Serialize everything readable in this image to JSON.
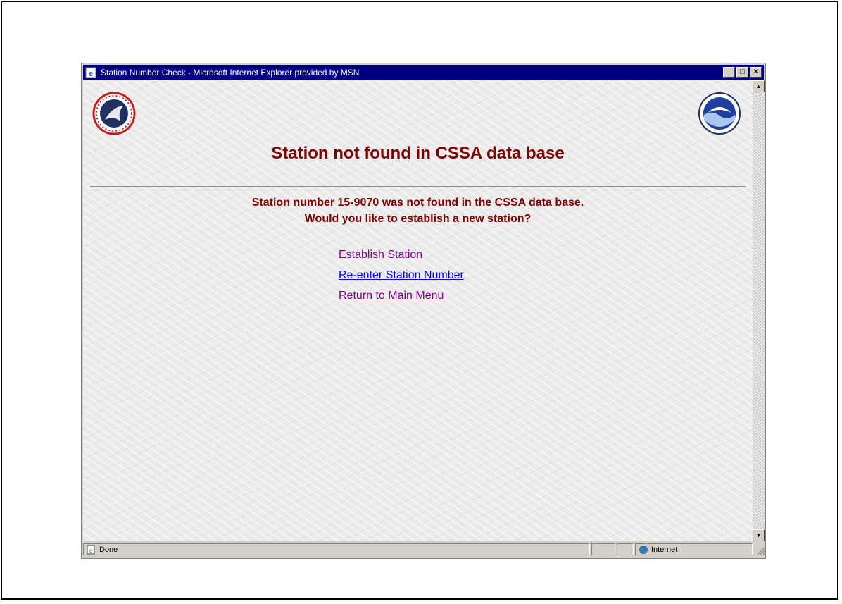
{
  "window": {
    "title": "Station Number Check - Microsoft Internet Explorer provided by MSN",
    "minimize": "_",
    "maximize": "□",
    "close": "×"
  },
  "page": {
    "heading": "Station not found in CSSA data base",
    "message_line1": "Station number 15-9070 was not found in the CSSA data base.",
    "message_line2": "Would you like to establish a new station?",
    "links": [
      {
        "label": "Establish Station"
      },
      {
        "label": "Re-enter Station Number"
      },
      {
        "label": "Return to Main Menu"
      }
    ]
  },
  "statusbar": {
    "status_text": "Done",
    "zone_text": "Internet"
  },
  "icons": {
    "left_logo": "nws-logo-icon",
    "right_logo": "noaa-logo-icon",
    "title_icon": "ie-icon",
    "zone_icon": "globe-icon"
  },
  "colors": {
    "titlebar": "#000080",
    "heading": "#800000",
    "link": "#0000ee",
    "visited_link": "#800080"
  }
}
